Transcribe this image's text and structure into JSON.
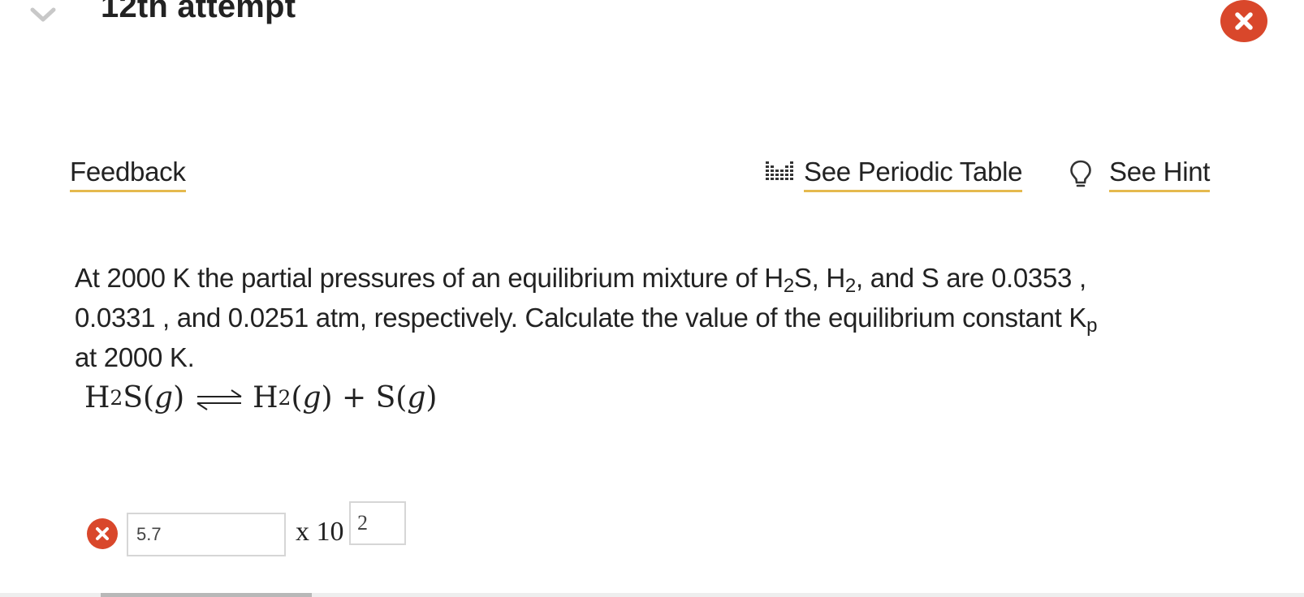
{
  "header": {
    "attempt_title": "12th attempt",
    "collapse_icon": "chevron-down-icon",
    "close_icon": "close-icon"
  },
  "toolbar": {
    "feedback_label": "Feedback",
    "periodic_table_label": "See Periodic Table",
    "periodic_table_icon": "periodic-table-icon",
    "hint_label": "See Hint",
    "hint_icon": "lightbulb-icon",
    "link_underline_color": "#e5b94e"
  },
  "question": {
    "line1_a": "At 2000 K the partial pressures of an equilibrium mixture of H",
    "sub_2a": "2",
    "line1_b": "S, H",
    "sub_2b": "2",
    "line1_c": ", and S are 0.0353 ,",
    "line2_a": "0.0331 , and 0.0251  atm, respectively. Calculate the value of the equilibrium constant K",
    "sub_p": "p",
    "line3": "at 2000 K."
  },
  "equation": {
    "h": "H",
    "sub1": "2",
    "left_rest": "S(",
    "g1": "g",
    "close1": ")",
    "h2": "H",
    "sub2": "2",
    "open2": "(",
    "g2": "g",
    "mid": ") + S(",
    "g3": "g",
    "close3": ")"
  },
  "answer": {
    "status_icon": "incorrect-icon",
    "mantissa_value": "5.7",
    "times_label": "x 10",
    "exponent_value": "2",
    "status_color": "#d9472b"
  }
}
